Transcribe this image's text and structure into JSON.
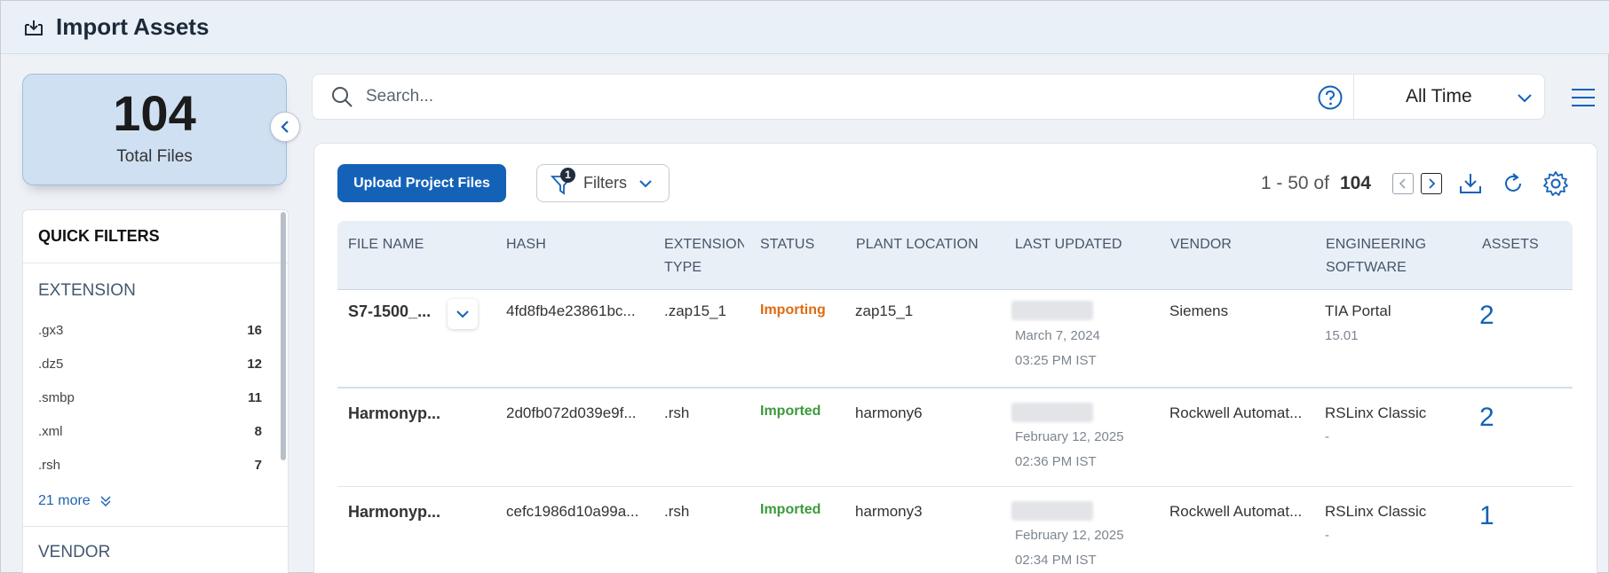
{
  "header": {
    "title": "Import Assets",
    "icon": "import-tray-icon"
  },
  "summary": {
    "total": "104",
    "label": "Total Files"
  },
  "quick_filters": {
    "title": "QUICK FILTERS",
    "extension_section": "EXTENSION",
    "extensions": [
      {
        "label": ".gx3",
        "count": "16"
      },
      {
        "label": ".dz5",
        "count": "12"
      },
      {
        "label": ".smbp",
        "count": "11"
      },
      {
        "label": ".xml",
        "count": "8"
      },
      {
        "label": ".rsh",
        "count": "7"
      }
    ],
    "more_label": "21 more",
    "vendor_section": "VENDOR"
  },
  "search": {
    "placeholder": "Search..."
  },
  "time_filter": {
    "value": "All Time"
  },
  "toolbar": {
    "upload_label": "Upload Project Files",
    "filters_label": "Filters",
    "filters_count": "1"
  },
  "pagination": {
    "range": "1 - 50 of",
    "total": "104"
  },
  "columns": {
    "file_name": "FILE NAME",
    "hash": "HASH",
    "extension_type": "EXTENSION TYPE",
    "status": "STATUS",
    "plant_location": "PLANT LOCATION",
    "last_updated": "LAST UPDATED",
    "vendor": "VENDOR",
    "engineering_software": "ENGINEERING SOFTWARE",
    "assets": "ASSETS"
  },
  "rows": [
    {
      "file_name": "S7-1500_...",
      "hash": "4fd8fb4e23861bc...",
      "extension": ".zap15_1",
      "status": "Importing",
      "plant_location": "zap15_1",
      "date": "March 7, 2024",
      "time": "03:25 PM IST",
      "vendor": "Siemens",
      "software": "TIA Portal",
      "software_version": "15.01",
      "assets": "2"
    },
    {
      "file_name": "Harmonyp...",
      "hash": "2d0fb072d039e9f...",
      "extension": ".rsh",
      "status": "Imported",
      "plant_location": "harmony6",
      "date": "February 12, 2025",
      "time": "02:36 PM IST",
      "vendor": "Rockwell Automat...",
      "software": "RSLinx Classic",
      "software_version": "-",
      "assets": "2"
    },
    {
      "file_name": "Harmonyp...",
      "hash": "cefc1986d10a99a...",
      "extension": ".rsh",
      "status": "Imported",
      "plant_location": "harmony3",
      "date": "February 12, 2025",
      "time": "02:34 PM IST",
      "vendor": "Rockwell Automat...",
      "software": "RSLinx Classic",
      "software_version": "-",
      "assets": "1"
    }
  ],
  "colors": {
    "primary": "#1462b8",
    "importing": "#e06a10",
    "imported": "#3b9a3b",
    "summary_bg": "#cfe0f2"
  }
}
